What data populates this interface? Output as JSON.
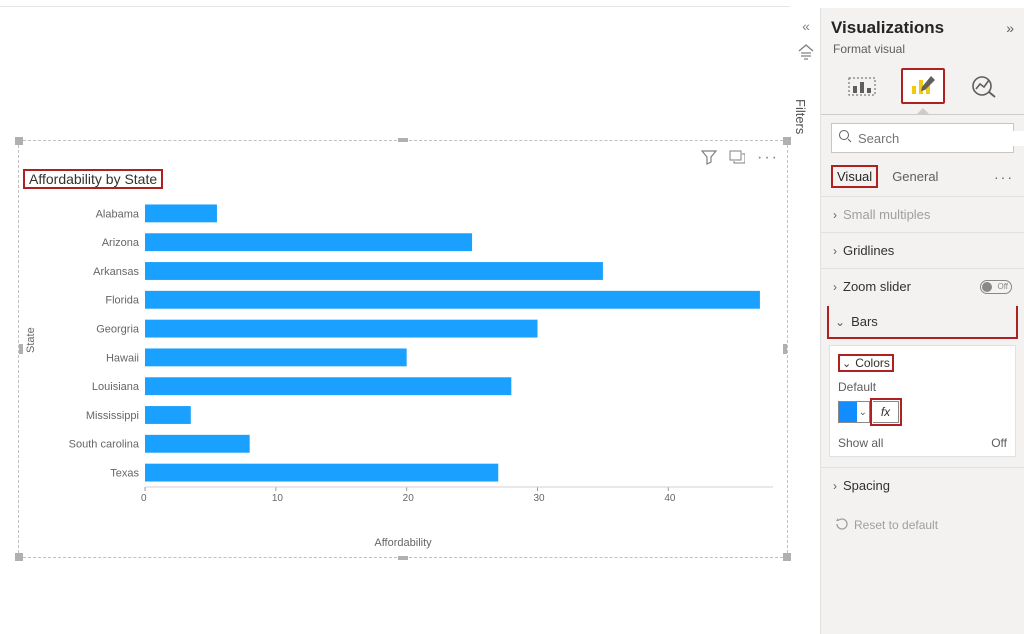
{
  "filters_tab": {
    "label": "Filters"
  },
  "viz_panel": {
    "title": "Visualizations",
    "subtitle": "Format visual",
    "search_placeholder": "Search",
    "tabs": {
      "visual": "Visual",
      "general": "General"
    },
    "sections": {
      "small_multiples": "Small multiples",
      "gridlines": "Gridlines",
      "zoom_slider": "Zoom slider",
      "bars": "Bars",
      "colors": "Colors",
      "default_label": "Default",
      "fx_label": "fx",
      "show_all": "Show all",
      "spacing": "Spacing",
      "reset": "Reset to default",
      "toggle_off": "Off"
    },
    "colors": {
      "default_swatch": "#118dff"
    }
  },
  "chart_data": {
    "type": "bar",
    "orientation": "horizontal",
    "title": "Affordability by State",
    "xlabel": "Affordability",
    "ylabel": "State",
    "x_ticks": [
      0,
      10,
      20,
      30,
      40
    ],
    "xlim": [
      0,
      48
    ],
    "categories": [
      "Alabama",
      "Arizona",
      "Arkansas",
      "Florida",
      "Georgria",
      "Hawaii",
      "Louisiana",
      "Mississippi",
      "South carolina",
      "Texas"
    ],
    "values": [
      5.5,
      25,
      35,
      47,
      30,
      20,
      28,
      3.5,
      8,
      27
    ],
    "bar_color": "#1aa0ff"
  }
}
